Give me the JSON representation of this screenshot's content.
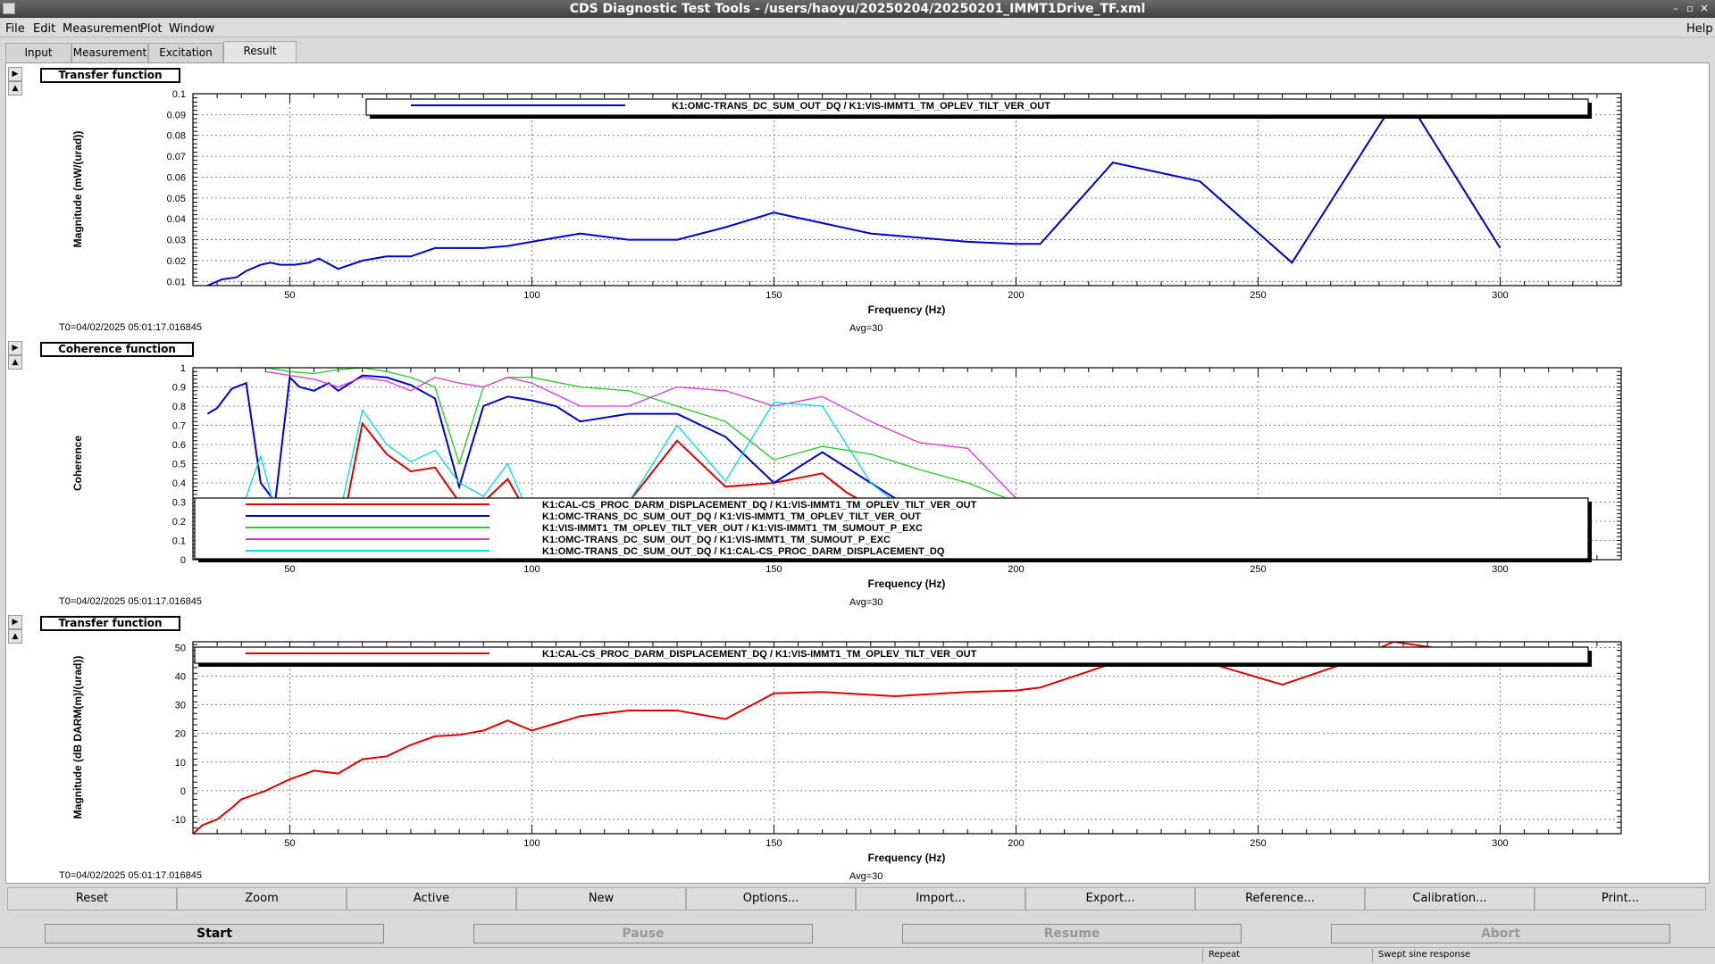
{
  "window": {
    "title": "CDS Diagnostic Test Tools - /users/haoyu/20250204/20250201_IMMT1Drive_TF.xml",
    "controls": [
      "–",
      "▫",
      "✕"
    ]
  },
  "menu": [
    {
      "label": "File"
    },
    {
      "label": "Edit"
    },
    {
      "label": "Measurement"
    },
    {
      "label": "Plot"
    },
    {
      "label": "Window"
    }
  ],
  "help_label": "Help",
  "tabs": [
    {
      "label": "Input",
      "active": false
    },
    {
      "label": "Measurement",
      "active": false
    },
    {
      "label": "Excitation",
      "active": false
    },
    {
      "label": "Result",
      "active": true
    }
  ],
  "panels": [
    {
      "title": "Transfer function",
      "ylabel": "Magnitude (mW/(urad))",
      "xlabel": "Frequency (Hz)",
      "t0": "T0=04/02/2025 05:01:17.016845",
      "avg": "Avg=30",
      "legend": [
        {
          "label": "K1:OMC-TRANS_DC_SUM_OUT_DQ / K1:VIS-IMMT1_TM_OPLEV_TILT_VER_OUT",
          "color": "#0000cc"
        }
      ]
    },
    {
      "title": "Coherence function",
      "ylabel": "Coherence",
      "xlabel": "Frequency (Hz)",
      "t0": "T0=04/02/2025 05:01:17.016845",
      "avg": "Avg=30",
      "legend": [
        {
          "label": "K1:CAL-CS_PROC_DARM_DISPLACEMENT_DQ / K1:VIS-IMMT1_TM_OPLEV_TILT_VER_OUT",
          "color": "#e00000"
        },
        {
          "label": "K1:OMC-TRANS_DC_SUM_OUT_DQ / K1:VIS-IMMT1_TM_OPLEV_TILT_VER_OUT",
          "color": "#0000cc"
        },
        {
          "label": "K1:VIS-IMMT1_TM_OPLEV_TILT_VER_OUT / K1:VIS-IMMT1_TM_SUMOUT_P_EXC",
          "color": "#22cc22"
        },
        {
          "label": "K1:OMC-TRANS_DC_SUM_OUT_DQ / K1:VIS-IMMT1_TM_SUMOUT_P_EXC",
          "color": "#dd33dd"
        },
        {
          "label": "K1:OMC-TRANS_DC_SUM_OUT_DQ / K1:CAL-CS_PROC_DARM_DISPLACEMENT_DQ",
          "color": "#00e0e0"
        }
      ]
    },
    {
      "title": "Transfer function",
      "ylabel": "Magnitude (dB DARM(m)/(urad))",
      "xlabel": "Frequency (Hz)",
      "t0": "T0=04/02/2025 05:01:17.016845",
      "avg": "Avg=30",
      "legend": [
        {
          "label": "K1:CAL-CS_PROC_DARM_DISPLACEMENT_DQ / K1:VIS-IMMT1_TM_OPLEV_TILT_VER_OUT",
          "color": "#e00000"
        }
      ]
    }
  ],
  "chart_data": [
    {
      "type": "line",
      "xlim": [
        30,
        325
      ],
      "ylim": [
        0.008,
        0.1
      ],
      "xticks": [
        50,
        100,
        150,
        200,
        250,
        300
      ],
      "yticks": [
        0.01,
        0.02,
        0.03,
        0.04,
        0.05,
        0.06,
        0.07,
        0.08,
        0.09,
        0.1
      ],
      "grid": true,
      "legend_position": "top",
      "series": [
        {
          "name": "K1:OMC-TRANS_DC_SUM_OUT_DQ / K1:VIS-IMMT1_TM_OPLEV_TILT_VER_OUT",
          "color": "#0000cc",
          "x": [
            33,
            36,
            39,
            41,
            44,
            46,
            48,
            51,
            54,
            56,
            60,
            65,
            70,
            75,
            80,
            85,
            90,
            95,
            100,
            110,
            120,
            130,
            140,
            150,
            160,
            170,
            180,
            190,
            200,
            205,
            220,
            238,
            257,
            277,
            282,
            300
          ],
          "y": [
            0.008,
            0.011,
            0.012,
            0.015,
            0.018,
            0.019,
            0.018,
            0.018,
            0.019,
            0.021,
            0.016,
            0.02,
            0.022,
            0.022,
            0.026,
            0.026,
            0.026,
            0.027,
            0.029,
            0.033,
            0.03,
            0.03,
            0.036,
            0.043,
            0.038,
            0.033,
            0.031,
            0.029,
            0.028,
            0.028,
            0.067,
            0.058,
            0.019,
            0.092,
            0.093,
            0.026
          ]
        }
      ]
    },
    {
      "type": "line",
      "xlim": [
        30,
        325
      ],
      "ylim": [
        0,
        1
      ],
      "xticks": [
        50,
        100,
        150,
        200,
        250,
        300
      ],
      "yticks": [
        0,
        0.1,
        0.2,
        0.3,
        0.4,
        0.5,
        0.6,
        0.7,
        0.8,
        0.9,
        1
      ],
      "grid": true,
      "legend_position": "bottom",
      "series": [
        {
          "name": "K1:CAL-CS_PROC_DARM_DISPLACEMENT_DQ / K1:VIS-IMMT1_TM_OPLEV_TILT_VER_OUT",
          "color": "#e00000",
          "x": [
            33,
            36,
            40,
            44,
            48,
            52,
            56,
            60,
            65,
            70,
            75,
            80,
            85,
            90,
            95,
            100,
            110,
            120,
            130,
            140,
            150,
            160,
            165,
            170,
            175
          ],
          "y": [
            0.1,
            0.1,
            0.08,
            0.06,
            0.05,
            0.06,
            0.06,
            0.06,
            0.71,
            0.55,
            0.46,
            0.48,
            0.3,
            0.3,
            0.42,
            0.2,
            0.2,
            0.3,
            0.62,
            0.38,
            0.4,
            0.45,
            0.35,
            0.28,
            0.2
          ]
        },
        {
          "name": "K1:OMC-TRANS_DC_SUM_OUT_DQ / K1:VIS-IMMT1_TM_OPLEV_TILT_VER_OUT",
          "color": "#0000cc",
          "x": [
            33,
            35,
            38,
            41,
            44,
            47,
            50,
            52,
            55,
            58,
            60,
            65,
            70,
            75,
            80,
            85,
            90,
            95,
            100,
            105,
            110,
            120,
            130,
            140,
            150,
            160,
            170,
            175
          ],
          "y": [
            0.76,
            0.79,
            0.89,
            0.92,
            0.4,
            0.3,
            0.95,
            0.9,
            0.88,
            0.92,
            0.88,
            0.96,
            0.95,
            0.91,
            0.84,
            0.38,
            0.8,
            0.85,
            0.83,
            0.8,
            0.72,
            0.76,
            0.76,
            0.64,
            0.4,
            0.56,
            0.4,
            0.32
          ]
        },
        {
          "name": "K1:VIS-IMMT1_TM_OPLEV_TILT_VER_OUT / K1:VIS-IMMT1_TM_SUMOUT_P_EXC",
          "color": "#22cc22",
          "x": [
            33,
            40,
            45,
            50,
            55,
            60,
            65,
            70,
            75,
            80,
            85,
            90,
            95,
            100,
            110,
            120,
            130,
            140,
            150,
            160,
            170,
            180,
            190,
            200,
            210
          ],
          "y": [
            1.0,
            1.0,
            1.0,
            0.98,
            0.97,
            0.99,
            1.0,
            0.98,
            0.95,
            0.9,
            0.5,
            0.9,
            0.95,
            0.95,
            0.9,
            0.88,
            0.8,
            0.72,
            0.52,
            0.59,
            0.55,
            0.47,
            0.4,
            0.3,
            0.2
          ]
        },
        {
          "name": "K1:OMC-TRANS_DC_SUM_OUT_DQ / K1:VIS-IMMT1_TM_SUMOUT_P_EXC",
          "color": "#dd33dd",
          "x": [
            45,
            50,
            55,
            60,
            65,
            70,
            75,
            80,
            85,
            90,
            95,
            100,
            110,
            120,
            130,
            140,
            150,
            160,
            170,
            180,
            190,
            200,
            210
          ],
          "y": [
            0.98,
            0.96,
            0.94,
            0.9,
            0.95,
            0.93,
            0.88,
            0.95,
            0.92,
            0.9,
            0.95,
            0.92,
            0.8,
            0.8,
            0.9,
            0.88,
            0.8,
            0.85,
            0.72,
            0.61,
            0.58,
            0.32,
            0.2
          ]
        },
        {
          "name": "K1:OMC-TRANS_DC_SUM_OUT_DQ / K1:CAL-CS_PROC_DARM_DISPLACEMENT_DQ",
          "color": "#00e0e0",
          "x": [
            33,
            36,
            40,
            42,
            44,
            46,
            48,
            52,
            56,
            60,
            65,
            70,
            75,
            80,
            85,
            90,
            95,
            100,
            110,
            120,
            130,
            140,
            150,
            160,
            170,
            175
          ],
          "y": [
            0.2,
            0.22,
            0.25,
            0.4,
            0.54,
            0.35,
            0.15,
            0.1,
            0.1,
            0.2,
            0.78,
            0.6,
            0.51,
            0.57,
            0.4,
            0.33,
            0.5,
            0.2,
            0.25,
            0.3,
            0.7,
            0.41,
            0.82,
            0.8,
            0.4,
            0.3
          ]
        }
      ]
    },
    {
      "type": "line",
      "xlim": [
        30,
        325
      ],
      "ylim": [
        -15,
        52
      ],
      "xticks": [
        50,
        100,
        150,
        200,
        250,
        300
      ],
      "yticks": [
        -10,
        0,
        10,
        20,
        30,
        40,
        50
      ],
      "grid": true,
      "legend_position": "top",
      "series": [
        {
          "name": "K1:CAL-CS_PROC_DARM_DISPLACEMENT_DQ / K1:VIS-IMMT1_TM_OPLEV_TILT_VER_OUT",
          "color": "#e00000",
          "x": [
            30,
            32,
            35,
            38,
            40,
            45,
            50,
            55,
            60,
            65,
            70,
            75,
            80,
            85,
            90,
            95,
            100,
            110,
            120,
            130,
            140,
            150,
            160,
            175,
            190,
            200,
            205,
            220,
            240,
            255,
            268,
            278,
            286
          ],
          "y": [
            -15,
            -12,
            -10,
            -6,
            -3,
            0,
            4,
            7,
            6,
            11,
            12,
            16,
            19,
            19.5,
            21,
            24.5,
            21,
            26,
            28,
            28,
            25,
            34,
            34.5,
            33,
            34.5,
            35,
            36,
            44.5,
            44.5,
            37,
            44.5,
            52,
            50
          ]
        }
      ]
    }
  ],
  "action_buttons": [
    "Reset",
    "Zoom",
    "Active",
    "New",
    "Options...",
    "Import...",
    "Export...",
    "Reference...",
    "Calibration...",
    "Print..."
  ],
  "run_buttons": [
    {
      "label": "Start",
      "enabled": true
    },
    {
      "label": "Pause",
      "enabled": false
    },
    {
      "label": "Resume",
      "enabled": false
    },
    {
      "label": "Abort",
      "enabled": false
    }
  ],
  "status": {
    "mode": "Repeat",
    "type": "Swept sine response"
  }
}
